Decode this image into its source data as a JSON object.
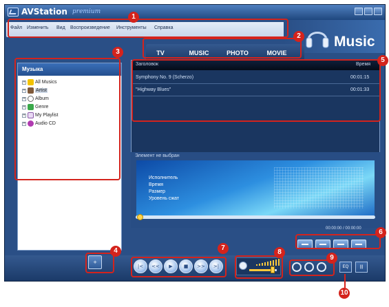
{
  "window": {
    "app_name": "AVStation",
    "app_edition": "premium"
  },
  "menu": [
    "Файл",
    "Изменить",
    "Вид",
    "Воспроизведение",
    "Инструменты",
    "Справка"
  ],
  "header": {
    "mode_label": "Music"
  },
  "tabs": [
    "TV",
    "MUSIC",
    "PHOTO",
    "MOVIE"
  ],
  "library": {
    "title": "Музыка",
    "items": [
      "All Musics",
      "Artist",
      "Album",
      "Genre",
      "My Playlist",
      "Audio CD"
    ]
  },
  "playlist": {
    "columns": [
      "Заголовок",
      "Время"
    ],
    "rows": [
      {
        "title": "Symphony No. 9 (Scherzo)",
        "time": "00:01:15"
      },
      {
        "title": "\"Highway Blues\"",
        "time": "00:01:33"
      }
    ]
  },
  "info": {
    "status": "Элемент не выбран",
    "fields": [
      "Исполнитель",
      "Время",
      "Размер",
      "Уровень сжат"
    ]
  },
  "playback": {
    "time": "00:00:00 / 00:00:00",
    "position": 0,
    "volume": 0.85
  },
  "callouts": [
    "1",
    "2",
    "3",
    "4",
    "5",
    "6",
    "7",
    "8",
    "9",
    "10"
  ],
  "buttons": {
    "eq_label": "EQ"
  },
  "colors": {
    "accent": "#d4231c",
    "frame": "#2a4f86",
    "highlight": "#ffc93a"
  }
}
